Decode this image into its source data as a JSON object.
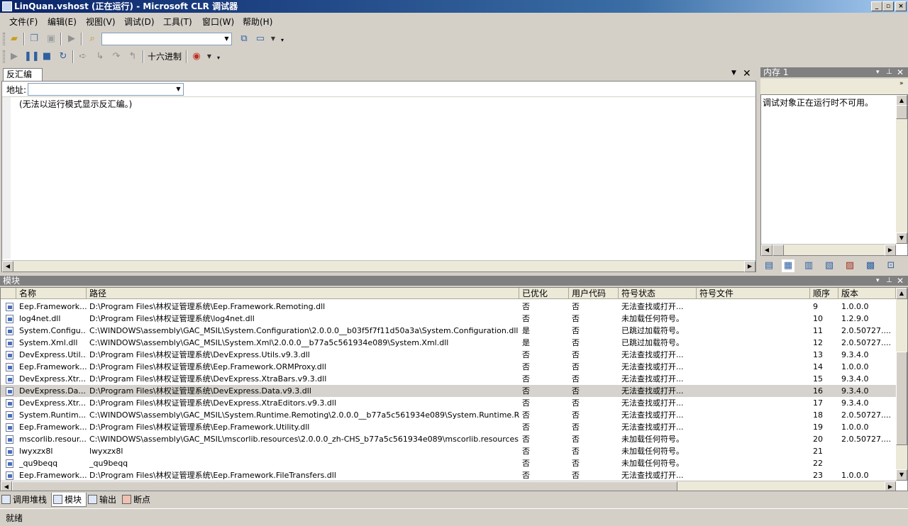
{
  "window": {
    "title": "LinQuan.vshost (正在运行) - Microsoft CLR 调试器",
    "caption_buttons": [
      "_",
      "▫",
      "×"
    ]
  },
  "menu": [
    "文件(F)",
    "编辑(E)",
    "视图(V)",
    "调试(D)",
    "工具(T)",
    "窗口(W)",
    "帮助(H)"
  ],
  "toolbar2": {
    "hex_label": "十六进制"
  },
  "disassembly": {
    "tab_label": "反汇编",
    "address_label": "地址:",
    "message": "(无法以运行模式显示反汇编。)"
  },
  "memory": {
    "title": "内存 1",
    "message": "调试对象正在运行时不可用。"
  },
  "modules": {
    "title": "模块",
    "columns": [
      "名称",
      "路径",
      "已优化",
      "用户代码",
      "符号状态",
      "符号文件",
      "顺序",
      "版本"
    ],
    "selected_index": 7,
    "rows": [
      [
        "Eep.Framework...",
        "D:\\Program Files\\林权证管理系统\\Eep.Framework.Remoting.dll",
        "否",
        "否",
        "无法查找或打开...",
        "",
        "9",
        "1.0.0.0"
      ],
      [
        "log4net.dll",
        "D:\\Program Files\\林权证管理系统\\log4net.dll",
        "否",
        "否",
        "未加载任何符号。",
        "",
        "10",
        "1.2.9.0"
      ],
      [
        "System.Configu...",
        "C:\\WINDOWS\\assembly\\GAC_MSIL\\System.Configuration\\2.0.0.0__b03f5f7f11d50a3a\\System.Configuration.dll",
        "是",
        "否",
        "已跳过加载符号。",
        "",
        "11",
        "2.0.50727...."
      ],
      [
        "System.Xml.dll",
        "C:\\WINDOWS\\assembly\\GAC_MSIL\\System.Xml\\2.0.0.0__b77a5c561934e089\\System.Xml.dll",
        "是",
        "否",
        "已跳过加载符号。",
        "",
        "12",
        "2.0.50727...."
      ],
      [
        "DevExpress.Util...",
        "D:\\Program Files\\林权证管理系统\\DevExpress.Utils.v9.3.dll",
        "否",
        "否",
        "无法查找或打开...",
        "",
        "13",
        "9.3.4.0"
      ],
      [
        "Eep.Framework...",
        "D:\\Program Files\\林权证管理系统\\Eep.Framework.ORMProxy.dll",
        "否",
        "否",
        "无法查找或打开...",
        "",
        "14",
        "1.0.0.0"
      ],
      [
        "DevExpress.Xtr...",
        "D:\\Program Files\\林权证管理系统\\DevExpress.XtraBars.v9.3.dll",
        "否",
        "否",
        "无法查找或打开...",
        "",
        "15",
        "9.3.4.0"
      ],
      [
        "DevExpress.Da...",
        "D:\\Program Files\\林权证管理系统\\DevExpress.Data.v9.3.dll",
        "否",
        "否",
        "无法查找或打开...",
        "",
        "16",
        "9.3.4.0"
      ],
      [
        "DevExpress.Xtr...",
        "D:\\Program Files\\林权证管理系统\\DevExpress.XtraEditors.v9.3.dll",
        "否",
        "否",
        "无法查找或打开...",
        "",
        "17",
        "9.3.4.0"
      ],
      [
        "System.Runtim...",
        "C:\\WINDOWS\\assembly\\GAC_MSIL\\System.Runtime.Remoting\\2.0.0.0__b77a5c561934e089\\System.Runtime.Remoting.dll",
        "否",
        "否",
        "无法查找或打开...",
        "",
        "18",
        "2.0.50727...."
      ],
      [
        "Eep.Framework...",
        "D:\\Program Files\\林权证管理系统\\Eep.Framework.Utility.dll",
        "否",
        "否",
        "无法查找或打开...",
        "",
        "19",
        "1.0.0.0"
      ],
      [
        "mscorlib.resour...",
        "C:\\WINDOWS\\assembly\\GAC_MSIL\\mscorlib.resources\\2.0.0.0_zh-CHS_b77a5c561934e089\\mscorlib.resources.dll",
        "否",
        "否",
        "未加载任何符号。",
        "",
        "20",
        "2.0.50727...."
      ],
      [
        "lwyxzx8l",
        "lwyxzx8l",
        "否",
        "否",
        "未加载任何符号。",
        "",
        "21",
        ""
      ],
      [
        "_qu9beqq",
        "_qu9beqq",
        "否",
        "否",
        "未加载任何符号。",
        "",
        "22",
        ""
      ],
      [
        "Eep.Framework...",
        "D:\\Program Files\\林权证管理系统\\Eep.Framework.FileTransfers.dll",
        "否",
        "否",
        "无法查找或打开...",
        "",
        "23",
        "1.0.0.0"
      ]
    ]
  },
  "bottom_tabs": [
    "调用堆栈",
    "模块",
    "输出",
    "断点"
  ],
  "active_bottom_tab": 1,
  "status": "就绪",
  "colors": {
    "title_start": "#0a246a",
    "title_end": "#a6caf0",
    "panel_header": "#808080",
    "selected_row": "#d6d3ce"
  },
  "icons": [
    "open-file-icon",
    "copy-icon",
    "paste-icon",
    "start-icon",
    "find-icon",
    "continue-icon",
    "break-all-icon",
    "stop-icon",
    "restart-icon",
    "step-into-icon",
    "step-over-icon",
    "step-out-icon",
    "breakpoint-icon",
    "module-icon"
  ]
}
